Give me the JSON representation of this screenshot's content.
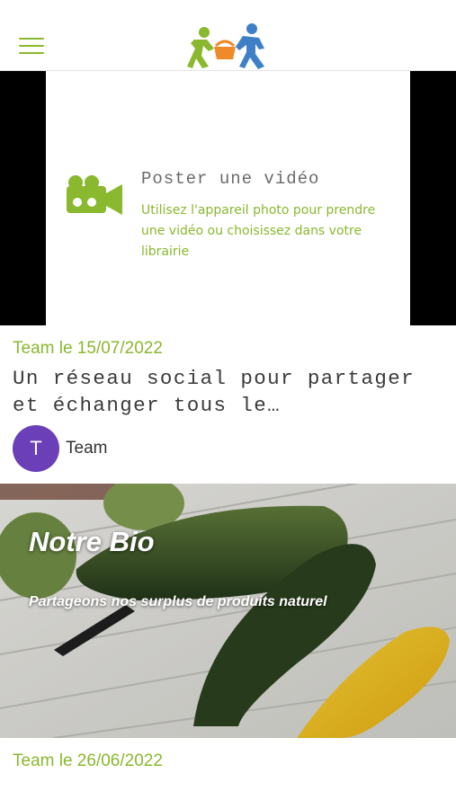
{
  "header": {
    "menu_icon": "hamburger-menu-icon",
    "logo_icon": "app-logo-icon"
  },
  "video_card": {
    "icon": "video-camera-icon",
    "title": "Poster une vidéo",
    "description": "Utilisez l'appareil photo pour prendre une vidéo ou choisissez dans votre librairie"
  },
  "posts": [
    {
      "meta": "Team le 15/07/2022",
      "title": "Un réseau social pour partager et échanger tous le…",
      "avatar_letter": "T",
      "author": "Team"
    },
    {
      "photo_title": "Notre Bio",
      "photo_subtitle": "Partageons nos surplus de produits naturel",
      "meta": "Team le 26/06/2022"
    }
  ],
  "colors": {
    "accent": "#8ab82f",
    "avatar": "#6a3fb8",
    "logo_blue": "#3f7fc7",
    "logo_orange": "#ef8a2a"
  }
}
